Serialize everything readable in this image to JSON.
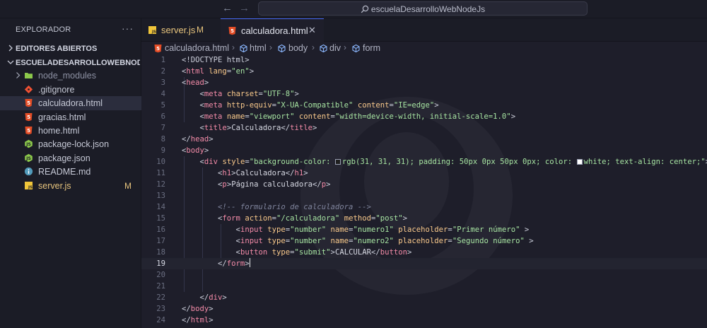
{
  "titlebar": {
    "search_text": "escuelaDesarrolloWebNodeJs",
    "back_glyph": "←",
    "forward_glyph": "→"
  },
  "sidebar": {
    "header": "EXPLORADOR",
    "more_glyph": "···",
    "sections": [
      {
        "label": "EDITORES ABIERTOS"
      },
      {
        "label": "ESCUELADESARROLLOWEBNODE..."
      }
    ],
    "items": [
      {
        "label": "node_modules",
        "icon": "folder-icon"
      },
      {
        "label": ".gitignore",
        "icon": "git-icon"
      },
      {
        "label": "calculadora.html",
        "icon": "html-icon"
      },
      {
        "label": "gracias.html",
        "icon": "html-icon"
      },
      {
        "label": "home.html",
        "icon": "html-icon"
      },
      {
        "label": "package-lock.json",
        "icon": "node-icon"
      },
      {
        "label": "package.json",
        "icon": "node-icon"
      },
      {
        "label": "README.md",
        "icon": "info-icon"
      },
      {
        "label": "server.js",
        "icon": "js-icon",
        "badge": "M"
      }
    ]
  },
  "tabs": [
    {
      "label": "server.js",
      "badge": "M",
      "icon": "js-icon"
    },
    {
      "label": "calculadora.html",
      "close": "✕",
      "icon": "html-icon"
    }
  ],
  "breadcrumb": {
    "file": "calculadora.html",
    "parts": [
      "html",
      "body",
      "div",
      "form"
    ],
    "separator": "›"
  },
  "editor": {
    "current_line": 19,
    "line_numbers": [
      "1",
      "2",
      "3",
      "4",
      "5",
      "6",
      "7",
      "8",
      "9",
      "10",
      "11",
      "12",
      "13",
      "14",
      "15",
      "16",
      "17",
      "18",
      "19",
      "20",
      "21",
      "22",
      "23",
      "24"
    ],
    "code": {
      "l1": "<!DOCTYPE html>",
      "l2_tag": "html",
      "l2_attr": "lang",
      "l2_val": "\"en\"",
      "l3_tag": "head",
      "l4_tag": "meta",
      "l4_attr": "charset",
      "l4_val": "\"UTF-8\"",
      "l5_tag": "meta",
      "l5_attr1": "http-equiv",
      "l5_val1": "\"X-UA-Compatible\"",
      "l5_attr2": "content",
      "l5_val2": "\"IE=edge\"",
      "l6_tag": "meta",
      "l6_attr1": "name",
      "l6_val1": "\"viewport\"",
      "l6_attr2": "content",
      "l6_val2": "\"width=device-width, initial-scale=1.0\"",
      "l7_tag": "title",
      "l7_text": "Calculadora",
      "l8_tag": "head",
      "l9_tag": "body",
      "l10_tag": "div",
      "l10_attr": "style",
      "l10_val_a": "\"background-color: ",
      "l10_val_b": "rgb(31, 31, 31); padding: 50px 0px 50px 0px; color: ",
      "l10_val_c": "white; text-align: center;\"",
      "l11_tag": "h1",
      "l11_text": "Calculadora",
      "l12_tag": "p",
      "l12_text": "Página calculadora",
      "l14_comment": "<!-- formulario de calculadora -->",
      "l15_tag": "form",
      "l15_attr1": "action",
      "l15_val1": "\"/calculadora\"",
      "l15_attr2": "method",
      "l15_val2": "\"post\"",
      "l16_tag": "input",
      "l16_attr1": "type",
      "l16_val1": "\"number\"",
      "l16_attr2": "name",
      "l16_val2": "\"numero1\"",
      "l16_attr3": "placeholder",
      "l16_val3": "\"Primer número\"",
      "l17_tag": "input",
      "l17_attr1": "type",
      "l17_val1": "\"number\"",
      "l17_attr2": "name",
      "l17_val2": "\"numero2\"",
      "l17_attr3": "placeholder",
      "l17_val3": "\"Segundo número\"",
      "l18_tag": "button",
      "l18_attr": "type",
      "l18_val": "\"submit\"",
      "l18_text": "CALCULAR",
      "l19_tag": "form",
      "l22_tag": "div",
      "l23_tag": "body",
      "l24_tag": "html"
    }
  },
  "colors": {
    "accent": "#4a6cf7",
    "html_icon": "#e44d26",
    "js_icon": "#f0c53a",
    "node_icon": "#8cc84b",
    "git_icon": "#f05133",
    "info_icon": "#519aba",
    "modified": "#e7c47d"
  }
}
